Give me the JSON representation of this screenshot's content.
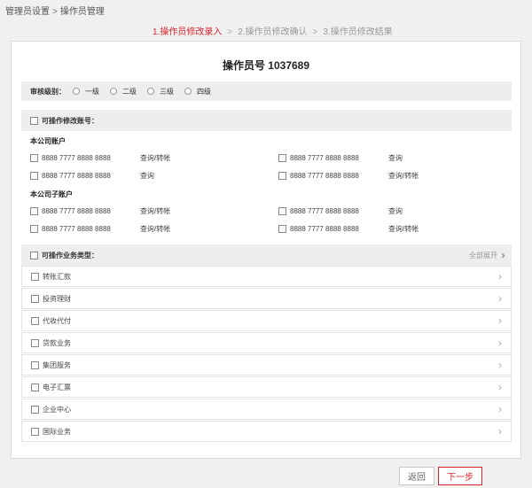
{
  "breadcrumb": {
    "parent": "管理员设置",
    "separator": ">",
    "current": "操作员管理"
  },
  "steps": [
    {
      "label": "1.操作员修改录入",
      "active": true
    },
    {
      "label": "2.操作员修改确认",
      "active": false
    },
    {
      "label": "3.操作员修改结果",
      "active": false
    }
  ],
  "step_arrow": ">",
  "title": "操作员号 1037689",
  "audit": {
    "label": "审核级别：",
    "options": [
      "一级",
      "二级",
      "三级",
      "四级"
    ]
  },
  "accounts_section": {
    "header": "可操作修改账号：",
    "company": {
      "label": "本公司账户",
      "items": [
        {
          "number": "8888 7777 8888 8888",
          "op": "查询/转帐"
        },
        {
          "number": "8888 7777 8888 8888",
          "op": "查询"
        },
        {
          "number": "8888 7777 8888 8888",
          "op": "查询"
        },
        {
          "number": "8888 7777 8888 8888",
          "op": "查询/转帐"
        }
      ]
    },
    "subsidiary": {
      "label": "本公司子账户",
      "items": [
        {
          "number": "8888 7777 8888 8888",
          "op": "查询/转帐"
        },
        {
          "number": "8888 7777 8888 8888",
          "op": "查询"
        },
        {
          "number": "8888 7777 8888 8888",
          "op": "查询/转帐"
        },
        {
          "number": "8888 7777 8888 8888",
          "op": "查询/转帐"
        }
      ]
    }
  },
  "business_section": {
    "header": "可操作业务类型：",
    "expand_all": "全部展开",
    "items": [
      "转账汇款",
      "投资理财",
      "代收代付",
      "贷款业务",
      "集团服务",
      "电子汇票",
      "企业中心",
      "国际业务"
    ]
  },
  "buttons": {
    "back": "返回",
    "next": "下一步"
  },
  "colors": {
    "accent": "#d8232a",
    "header_bg": "#eeeeee",
    "page_bg": "#f0f0f0"
  }
}
